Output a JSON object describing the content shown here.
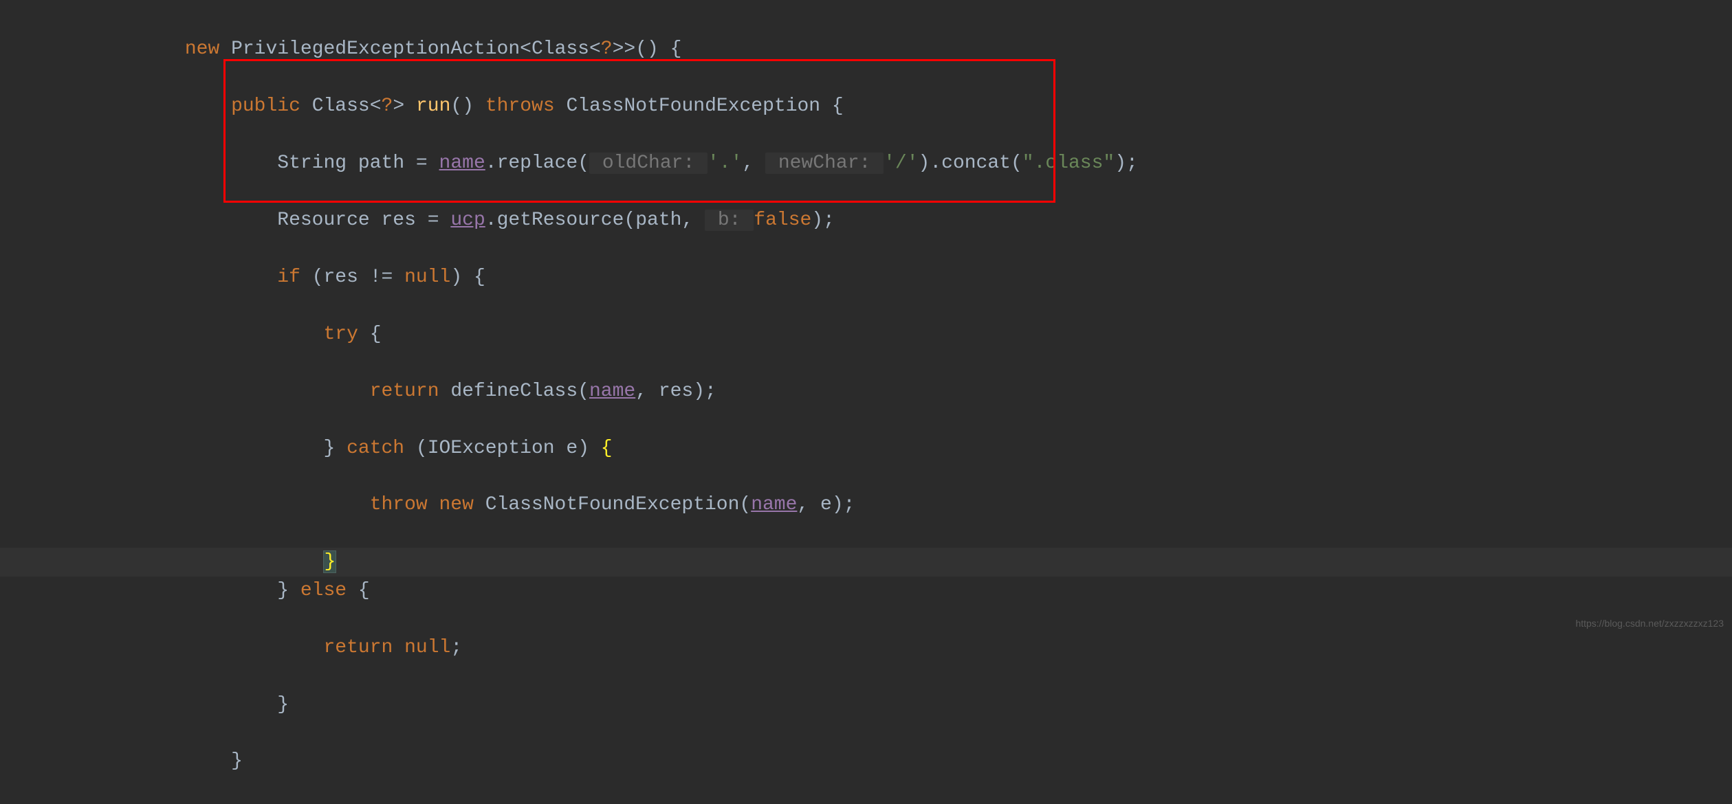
{
  "code": {
    "l1": {
      "new": "new",
      "type": "PrivilegedExceptionAction",
      "generic1": "<Class<",
      "wildcard": "?",
      "generic2": ">>() {"
    },
    "l2": {
      "public": "public",
      "returnType": "Class<",
      "wildcard": "?",
      "returnType2": ">",
      "method": "run",
      "parens": "()",
      "throws": "throws",
      "exception": "ClassNotFoundException",
      "brace": " {"
    },
    "l3": {
      "type": "String",
      "var": "path",
      "eq": " = ",
      "field": "name",
      "dot1": ".",
      "replace": "replace",
      "open": "(",
      "hint1": " oldChar: ",
      "arg1": "'.'",
      "comma": ", ",
      "hint2": " newChar: ",
      "arg2": "'/'",
      "close": ").",
      "concat": "concat",
      "open2": "(",
      "str": "\".class\"",
      "end": ");"
    },
    "l4": {
      "type": "Resource",
      "var": "res",
      "eq": " = ",
      "field": "ucp",
      "dot": ".",
      "method": "getResource",
      "open": "(",
      "arg1": "path",
      "comma": ", ",
      "hint": " b: ",
      "false": "false",
      "end": ");"
    },
    "l5": {
      "if": "if",
      "open": " (",
      "var": "res",
      "neq": " != ",
      "null": "null",
      "close": ") {"
    },
    "l6": {
      "try": "try",
      "brace": " {"
    },
    "l7": {
      "return": "return",
      "space": " ",
      "method": "defineClass",
      "open": "(",
      "field": "name",
      "comma": ", ",
      "var": "res",
      "end": ");"
    },
    "l8": {
      "close": "}",
      "catch": " catch",
      "open": " (",
      "type": "IOException",
      "var": " e",
      "close2": ") ",
      "brace": "{"
    },
    "l9": {
      "throw": "throw",
      "new": " new",
      "type": " ClassNotFoundException",
      "open": "(",
      "field": "name",
      "comma": ", ",
      "var": "e",
      "end": ");"
    },
    "l10": {
      "brace": "}"
    },
    "l11": {
      "close": "}",
      "else": " else",
      "brace": " {"
    },
    "l12": {
      "return": "return",
      "null": " null",
      "end": ";"
    },
    "l13": {
      "brace": "}"
    },
    "l14": {
      "brace": "}"
    }
  },
  "watermark": "https://blog.csdn.net/zxzzxzzxz123"
}
